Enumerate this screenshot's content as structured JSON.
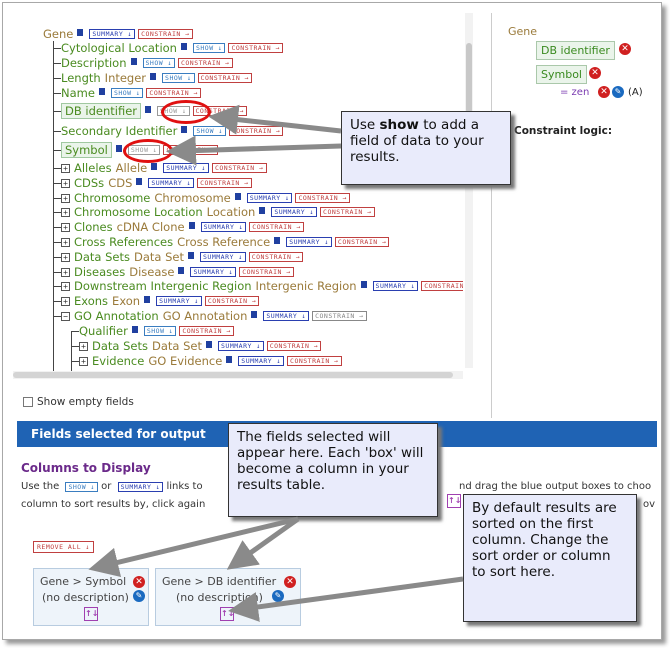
{
  "tree": {
    "root": "Gene",
    "children": [
      {
        "label": "Cytological Location",
        "style": "g",
        "show": "SHOW",
        "constrain": "CONSTRAIN"
      },
      {
        "label": "Description",
        "style": "g",
        "show": "SHOW",
        "constrain": "CONSTRAIN"
      },
      {
        "label": "Length",
        "style": "g",
        "type": "Integer",
        "show": "SHOW",
        "constrain": "CONSTRAIN"
      },
      {
        "label": "Name",
        "style": "g",
        "show": "SHOW",
        "constrain": "CONSTRAIN"
      },
      {
        "label": "DB identifier",
        "style": "g",
        "selected": true,
        "show": "SHOW",
        "constrain": "CONSTRAIN"
      },
      {
        "label": "Secondary Identifier",
        "style": "g",
        "show": "SHOW",
        "constrain": "CONSTRAIN"
      },
      {
        "label": "Symbol",
        "style": "g",
        "selected": true,
        "show": "SHOW",
        "constrain": "CONSTRAIN"
      },
      {
        "label": "Alleles",
        "type": "Allele",
        "show": "SUMMARY",
        "constrain": "CONSTRAIN"
      },
      {
        "label": "CDSs",
        "type": "CDS",
        "show": "SUMMARY",
        "constrain": "CONSTRAIN"
      },
      {
        "label": "Chromosome",
        "type": "Chromosome",
        "show": "SUMMARY",
        "constrain": "CONSTRAIN"
      },
      {
        "label": "Chromosome Location",
        "type": "Location",
        "show": "SUMMARY",
        "constrain": "CONSTRAIN"
      },
      {
        "label": "Clones",
        "type": "cDNA Clone",
        "show": "SUMMARY",
        "constrain": "CONSTRAIN"
      },
      {
        "label": "Cross References",
        "type": "Cross Reference",
        "show": "SUMMARY",
        "constrain": "CONSTRAIN"
      },
      {
        "label": "Data Sets",
        "type": "Data Set",
        "show": "SUMMARY",
        "constrain": "CONSTRAIN"
      },
      {
        "label": "Diseases",
        "type": "Disease",
        "show": "SUMMARY",
        "constrain": "CONSTRAIN"
      },
      {
        "label": "Downstream Intergenic Region",
        "type": "Intergenic Region",
        "show": "SUMMARY",
        "constrain": "CONSTRAIN"
      },
      {
        "label": "Exons",
        "type": "Exon",
        "show": "SUMMARY",
        "constrain": "CONSTRAIN"
      },
      {
        "label": "GO Annotation",
        "type": "GO Annotation",
        "show": "SUMMARY",
        "constrain": "CONSTRAIN"
      },
      {
        "label": "Qualifier",
        "show": "SHOW",
        "constrain": "CONSTRAIN"
      },
      {
        "label": "Data Sets",
        "type": "Data Set",
        "show": "SUMMARY",
        "constrain": "CONSTRAIN"
      },
      {
        "label": "Evidence",
        "type": "GO Evidence",
        "show": "SUMMARY",
        "constrain": "CONSTRAIN"
      }
    ]
  },
  "right_panel": {
    "title": "Gene",
    "db_identifier": "DB identifier",
    "symbol": "Symbol",
    "constraint": "= zen",
    "constraint_code": "(A)",
    "logic_label": "Constraint logic:"
  },
  "show_empty_fields": "Show empty fields",
  "fields_header": "Fields selected for output",
  "columns_title": "Columns to Display",
  "desc_line1_a": "Use the",
  "desc_line1_b": "or",
  "desc_line1_c": "links to",
  "desc_line1_end": "nd drag the blue output boxes to choo",
  "desc_line2_a": "column to sort results by, click again",
  "desc_line2_end": "ov",
  "show_btn": "SHOW",
  "summary_btn": "SUMMARY",
  "constrain_btn": "CONSTRAIN",
  "remove_all": "REMOVE ALL",
  "columns": [
    {
      "name": "Gene > Symbol",
      "desc": "(no description)"
    },
    {
      "name": "Gene > DB identifier",
      "desc": "(no description)"
    }
  ],
  "callouts": {
    "show_a": "Use ",
    "show_b": "show",
    "show_c": " to add a field of data to your results.",
    "fields": "The fields selected will appear here.  Each 'box' will become a column in your results table.",
    "sort": "By default results are sorted on the first column. Change the sort order or column to sort here."
  },
  "colors": {
    "accent_blue": "#1f63b4",
    "callout_bg": "#e9ebfb",
    "highlight_red": "#e01010",
    "field_green": "#4a8b20"
  }
}
